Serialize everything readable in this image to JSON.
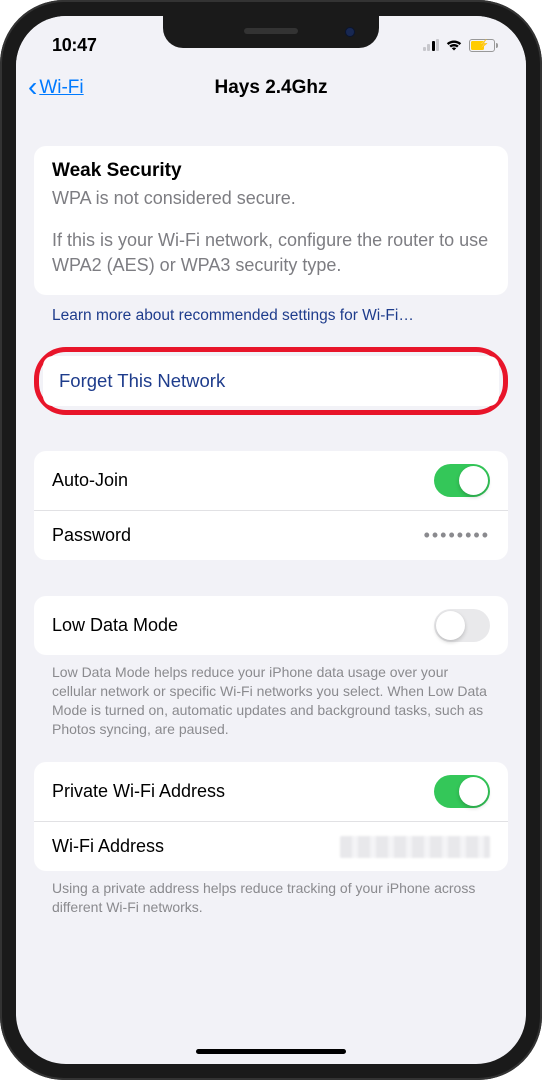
{
  "status": {
    "time": "10:47"
  },
  "nav": {
    "back_label": "Wi-Fi",
    "title": "Hays 2.4Ghz"
  },
  "security_card": {
    "title": "Weak Security",
    "subtitle": "WPA is not considered secure.",
    "body": "If this is your Wi-Fi network, configure the router to use WPA2 (AES) or WPA3 security type."
  },
  "learn_more": "Learn more about recommended settings for Wi-Fi…",
  "forget": "Forget This Network",
  "auto_join": {
    "label": "Auto-Join",
    "value": true
  },
  "password": {
    "label": "Password",
    "value": "••••••••"
  },
  "low_data": {
    "label": "Low Data Mode",
    "value": false,
    "footer": "Low Data Mode helps reduce your iPhone data usage over your cellular network or specific Wi-Fi networks you select. When Low Data Mode is turned on, automatic updates and background tasks, such as Photos syncing, are paused."
  },
  "private_wifi": {
    "label": "Private Wi-Fi Address",
    "value": true
  },
  "wifi_address": {
    "label": "Wi-Fi Address"
  },
  "private_footer": "Using a private address helps reduce tracking of your iPhone across different Wi-Fi networks."
}
